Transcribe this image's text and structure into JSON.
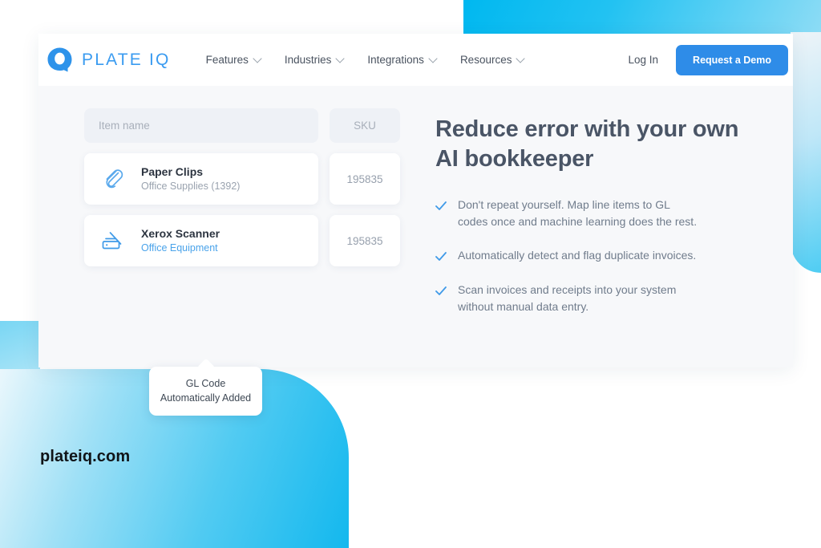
{
  "brand": {
    "logo_text": "PLATE IQ",
    "logo_icon": "plateiq-q-logo-icon",
    "accent_blue": "#2e8ce8",
    "cyan": "#13b8ee"
  },
  "nav": {
    "items": [
      {
        "label": "Features",
        "icon": "chevron-down-icon"
      },
      {
        "label": "Industries",
        "icon": "chevron-down-icon"
      },
      {
        "label": "Integrations",
        "icon": "chevron-down-icon"
      },
      {
        "label": "Resources",
        "icon": "chevron-down-icon"
      }
    ],
    "login_label": "Log In",
    "cta_label": "Request a Demo"
  },
  "table": {
    "headers": {
      "name": "Item name",
      "sku": "SKU"
    },
    "rows": [
      {
        "icon": "paperclip-icon",
        "title": "Paper Clips",
        "subtitle": "Office Supplies (1392)",
        "subtitle_is_link": false,
        "sku": "195835"
      },
      {
        "icon": "scanner-icon",
        "title": "Xerox Scanner",
        "subtitle": "Office Equipment",
        "subtitle_is_link": true,
        "sku": "195835"
      }
    ]
  },
  "tooltip": {
    "line1": "GL Code",
    "line2": "Automatically Added"
  },
  "hero": {
    "headline": "Reduce error with your own AI bookkeeper",
    "bullets": [
      {
        "icon": "check-icon",
        "text": "Don't repeat yourself. Map line items to GL codes once and machine learning does the rest."
      },
      {
        "icon": "check-icon",
        "text": "Automatically detect and flag duplicate invoices."
      },
      {
        "icon": "check-icon",
        "text": "Scan invoices and receipts into your system without manual data entry."
      }
    ]
  },
  "footer": {
    "url": "plateiq.com"
  }
}
